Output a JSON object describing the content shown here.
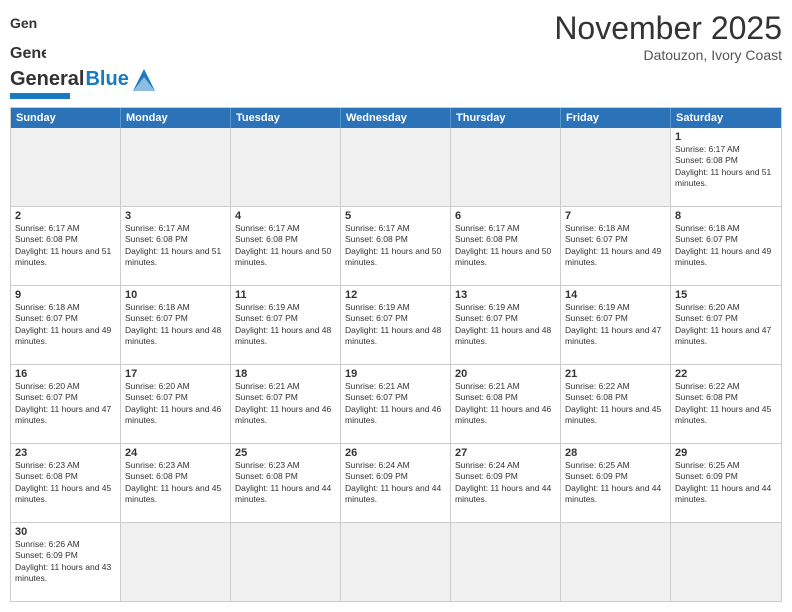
{
  "header": {
    "title": "November 2025",
    "subtitle": "Datouzon, Ivory Coast"
  },
  "dayHeaders": [
    "Sunday",
    "Monday",
    "Tuesday",
    "Wednesday",
    "Thursday",
    "Friday",
    "Saturday"
  ],
  "weeks": [
    [
      {
        "day": "",
        "empty": true
      },
      {
        "day": "",
        "empty": true
      },
      {
        "day": "",
        "empty": true
      },
      {
        "day": "",
        "empty": true
      },
      {
        "day": "",
        "empty": true
      },
      {
        "day": "",
        "empty": true
      },
      {
        "day": "1",
        "sunrise": "Sunrise: 6:17 AM",
        "sunset": "Sunset: 6:08 PM",
        "daylight": "Daylight: 11 hours and 51 minutes."
      }
    ],
    [
      {
        "day": "2",
        "sunrise": "Sunrise: 6:17 AM",
        "sunset": "Sunset: 6:08 PM",
        "daylight": "Daylight: 11 hours and 51 minutes."
      },
      {
        "day": "3",
        "sunrise": "Sunrise: 6:17 AM",
        "sunset": "Sunset: 6:08 PM",
        "daylight": "Daylight: 11 hours and 51 minutes."
      },
      {
        "day": "4",
        "sunrise": "Sunrise: 6:17 AM",
        "sunset": "Sunset: 6:08 PM",
        "daylight": "Daylight: 11 hours and 50 minutes."
      },
      {
        "day": "5",
        "sunrise": "Sunrise: 6:17 AM",
        "sunset": "Sunset: 6:08 PM",
        "daylight": "Daylight: 11 hours and 50 minutes."
      },
      {
        "day": "6",
        "sunrise": "Sunrise: 6:17 AM",
        "sunset": "Sunset: 6:08 PM",
        "daylight": "Daylight: 11 hours and 50 minutes."
      },
      {
        "day": "7",
        "sunrise": "Sunrise: 6:18 AM",
        "sunset": "Sunset: 6:07 PM",
        "daylight": "Daylight: 11 hours and 49 minutes."
      },
      {
        "day": "8",
        "sunrise": "Sunrise: 6:18 AM",
        "sunset": "Sunset: 6:07 PM",
        "daylight": "Daylight: 11 hours and 49 minutes."
      }
    ],
    [
      {
        "day": "9",
        "sunrise": "Sunrise: 6:18 AM",
        "sunset": "Sunset: 6:07 PM",
        "daylight": "Daylight: 11 hours and 49 minutes."
      },
      {
        "day": "10",
        "sunrise": "Sunrise: 6:18 AM",
        "sunset": "Sunset: 6:07 PM",
        "daylight": "Daylight: 11 hours and 48 minutes."
      },
      {
        "day": "11",
        "sunrise": "Sunrise: 6:19 AM",
        "sunset": "Sunset: 6:07 PM",
        "daylight": "Daylight: 11 hours and 48 minutes."
      },
      {
        "day": "12",
        "sunrise": "Sunrise: 6:19 AM",
        "sunset": "Sunset: 6:07 PM",
        "daylight": "Daylight: 11 hours and 48 minutes."
      },
      {
        "day": "13",
        "sunrise": "Sunrise: 6:19 AM",
        "sunset": "Sunset: 6:07 PM",
        "daylight": "Daylight: 11 hours and 48 minutes."
      },
      {
        "day": "14",
        "sunrise": "Sunrise: 6:19 AM",
        "sunset": "Sunset: 6:07 PM",
        "daylight": "Daylight: 11 hours and 47 minutes."
      },
      {
        "day": "15",
        "sunrise": "Sunrise: 6:20 AM",
        "sunset": "Sunset: 6:07 PM",
        "daylight": "Daylight: 11 hours and 47 minutes."
      }
    ],
    [
      {
        "day": "16",
        "sunrise": "Sunrise: 6:20 AM",
        "sunset": "Sunset: 6:07 PM",
        "daylight": "Daylight: 11 hours and 47 minutes."
      },
      {
        "day": "17",
        "sunrise": "Sunrise: 6:20 AM",
        "sunset": "Sunset: 6:07 PM",
        "daylight": "Daylight: 11 hours and 46 minutes."
      },
      {
        "day": "18",
        "sunrise": "Sunrise: 6:21 AM",
        "sunset": "Sunset: 6:07 PM",
        "daylight": "Daylight: 11 hours and 46 minutes."
      },
      {
        "day": "19",
        "sunrise": "Sunrise: 6:21 AM",
        "sunset": "Sunset: 6:07 PM",
        "daylight": "Daylight: 11 hours and 46 minutes."
      },
      {
        "day": "20",
        "sunrise": "Sunrise: 6:21 AM",
        "sunset": "Sunset: 6:08 PM",
        "daylight": "Daylight: 11 hours and 46 minutes."
      },
      {
        "day": "21",
        "sunrise": "Sunrise: 6:22 AM",
        "sunset": "Sunset: 6:08 PM",
        "daylight": "Daylight: 11 hours and 45 minutes."
      },
      {
        "day": "22",
        "sunrise": "Sunrise: 6:22 AM",
        "sunset": "Sunset: 6:08 PM",
        "daylight": "Daylight: 11 hours and 45 minutes."
      }
    ],
    [
      {
        "day": "23",
        "sunrise": "Sunrise: 6:23 AM",
        "sunset": "Sunset: 6:08 PM",
        "daylight": "Daylight: 11 hours and 45 minutes."
      },
      {
        "day": "24",
        "sunrise": "Sunrise: 6:23 AM",
        "sunset": "Sunset: 6:08 PM",
        "daylight": "Daylight: 11 hours and 45 minutes."
      },
      {
        "day": "25",
        "sunrise": "Sunrise: 6:23 AM",
        "sunset": "Sunset: 6:08 PM",
        "daylight": "Daylight: 11 hours and 44 minutes."
      },
      {
        "day": "26",
        "sunrise": "Sunrise: 6:24 AM",
        "sunset": "Sunset: 6:09 PM",
        "daylight": "Daylight: 11 hours and 44 minutes."
      },
      {
        "day": "27",
        "sunrise": "Sunrise: 6:24 AM",
        "sunset": "Sunset: 6:09 PM",
        "daylight": "Daylight: 11 hours and 44 minutes."
      },
      {
        "day": "28",
        "sunrise": "Sunrise: 6:25 AM",
        "sunset": "Sunset: 6:09 PM",
        "daylight": "Daylight: 11 hours and 44 minutes."
      },
      {
        "day": "29",
        "sunrise": "Sunrise: 6:25 AM",
        "sunset": "Sunset: 6:09 PM",
        "daylight": "Daylight: 11 hours and 44 minutes."
      }
    ],
    [
      {
        "day": "30",
        "sunrise": "Sunrise: 6:26 AM",
        "sunset": "Sunset: 6:09 PM",
        "daylight": "Daylight: 11 hours and 43 minutes."
      },
      {
        "day": "",
        "empty": true
      },
      {
        "day": "",
        "empty": true
      },
      {
        "day": "",
        "empty": true
      },
      {
        "day": "",
        "empty": true
      },
      {
        "day": "",
        "empty": true
      },
      {
        "day": "",
        "empty": true
      }
    ]
  ]
}
